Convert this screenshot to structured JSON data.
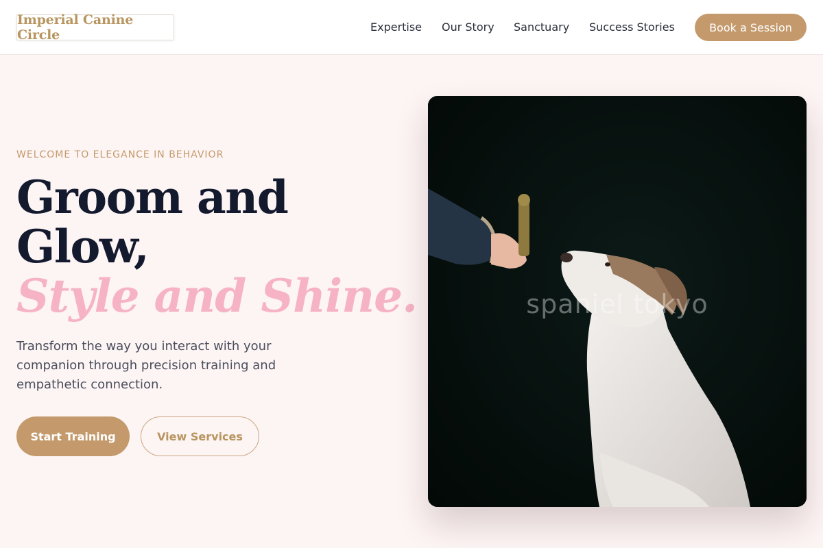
{
  "header": {
    "logo": "Imperial Canine Circle",
    "nav": [
      "Expertise",
      "Our Story",
      "Sanctuary",
      "Success Stories"
    ],
    "cta": "Book a Session"
  },
  "hero": {
    "eyebrow": "WELCOME TO ELEGANCE IN BEHAVIOR",
    "headline_line1": "Groom and",
    "headline_line2": "Glow,",
    "headline_accent": "Style and Shine.",
    "lead": "Transform the way you interact with your companion through precision training and empathetic connection.",
    "primary_button": "Start Training",
    "secondary_button": "View Services",
    "image": {
      "subject": "dog-looking-up-at-treat",
      "watermark": "spaniel tokyo"
    }
  },
  "colors": {
    "accent_gold": "#c49a6c",
    "accent_pink": "#f6b3c6",
    "heading_navy": "#141a2e",
    "background": "#fdf4f4"
  }
}
